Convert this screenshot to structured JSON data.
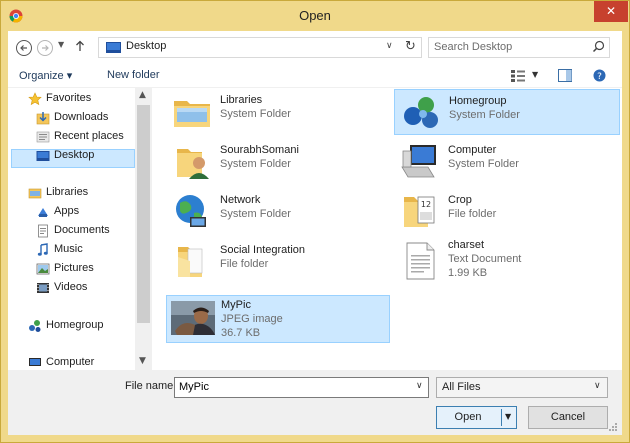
{
  "window": {
    "title": "Open",
    "close_label": "✕"
  },
  "navbar": {
    "address_label": "Desktop",
    "search_placeholder": "Search Desktop"
  },
  "toolbar": {
    "organize_label": "Organize ▾",
    "new_folder_label": "New folder"
  },
  "sidebar": {
    "items": [
      {
        "label": "Favorites",
        "icon": "star-icon"
      },
      {
        "label": "Downloads",
        "icon": "downloads-icon"
      },
      {
        "label": "Recent places",
        "icon": "recent-places-icon"
      },
      {
        "label": "Desktop",
        "icon": "desktop-icon",
        "selected": true
      },
      {
        "label": "Libraries",
        "icon": "libraries-icon"
      },
      {
        "label": "Apps",
        "icon": "apps-icon"
      },
      {
        "label": "Documents",
        "icon": "documents-icon"
      },
      {
        "label": "Music",
        "icon": "music-icon"
      },
      {
        "label": "Pictures",
        "icon": "pictures-icon"
      },
      {
        "label": "Videos",
        "icon": "videos-icon"
      },
      {
        "label": "Homegroup",
        "icon": "homegroup-icon"
      },
      {
        "label": "Computer",
        "icon": "computer-icon"
      }
    ]
  },
  "files": [
    {
      "name": "Libraries",
      "type": "System Folder",
      "icon": "libraries-folder-icon"
    },
    {
      "name": "Homegroup",
      "type": "System Folder",
      "icon": "homegroup-icon",
      "highlighted": true
    },
    {
      "name": "SourabhSomani",
      "type": "System Folder",
      "icon": "user-folder-icon"
    },
    {
      "name": "Computer",
      "type": "System Folder",
      "icon": "computer-icon"
    },
    {
      "name": "Network",
      "type": "System Folder",
      "icon": "network-globe-icon"
    },
    {
      "name": "Crop",
      "type": "File folder",
      "icon": "folder-icon"
    },
    {
      "name": "Social Integration",
      "type": "File folder",
      "icon": "folder-icon"
    },
    {
      "name": "charset",
      "type": "Text Document",
      "size": "1.99 KB",
      "icon": "text-document-icon"
    },
    {
      "name": "MyPic",
      "type": "JPEG image",
      "size": "36.7 KB",
      "icon": "image-thumbnail-icon",
      "selected": true
    }
  ],
  "footer": {
    "file_name_label": "File name:",
    "file_name_value": "MyPic",
    "file_type_value": "All Files",
    "open_label": "Open",
    "cancel_label": "Cancel"
  },
  "colors": {
    "title_bar": "#f0d98a",
    "close_button": "#c7412e",
    "selection": "#cce8ff",
    "selection_border": "#99d1ff"
  }
}
